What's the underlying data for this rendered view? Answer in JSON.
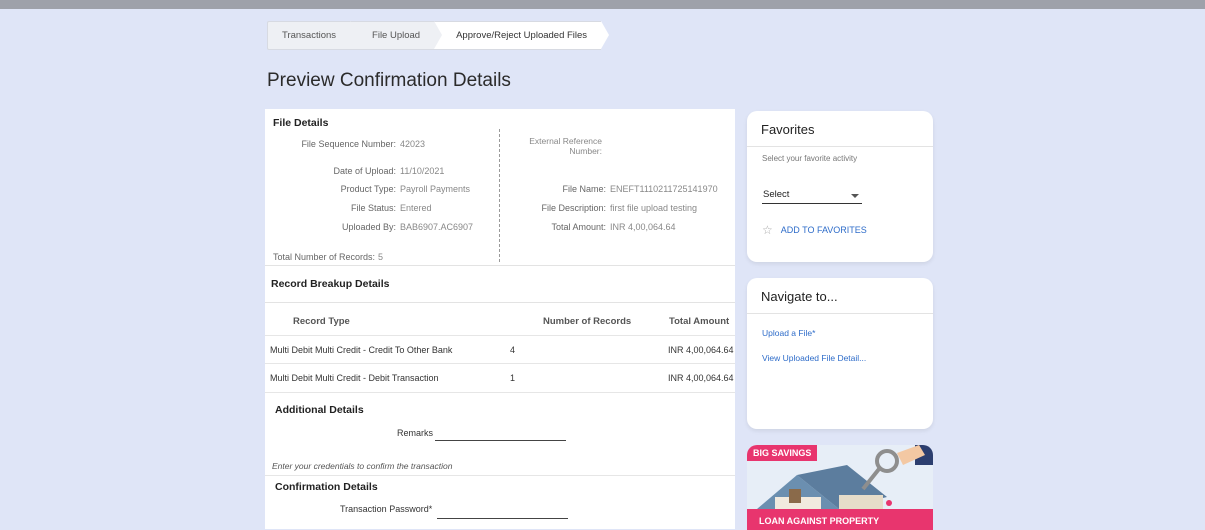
{
  "breadcrumb": [
    "Transactions",
    "File Upload",
    "Approve/Reject Uploaded Files"
  ],
  "page_title": "Preview Confirmation Details",
  "file_details": {
    "heading": "File Details",
    "left": [
      {
        "label": "File Sequence Number:",
        "value": "42023"
      },
      {
        "label": "Date of Upload:",
        "value": "11/10/2021"
      },
      {
        "label": "Product Type:",
        "value": "Payroll Payments"
      },
      {
        "label": "File Status:",
        "value": "Entered"
      },
      {
        "label": "Uploaded By:",
        "value": "BAB6907.AC6907"
      }
    ],
    "total_records_label": "Total Number of Records:",
    "total_records_value": "5",
    "external_ref_label": "External Reference Number:",
    "right": [
      {
        "label": "File Name:",
        "value": "ENEFT1110211725141970"
      },
      {
        "label": "File Description:",
        "value": "first file upload testing"
      },
      {
        "label": "Total Amount:",
        "value": "INR 4,00,064.64"
      }
    ]
  },
  "record_breakup": {
    "heading": "Record Breakup Details",
    "columns": [
      "Record Type",
      "Number of Records",
      "Total Amount"
    ],
    "rows": [
      {
        "type": "Multi Debit Multi Credit - Credit To Other Bank",
        "count": "4",
        "amount": "INR 4,00,064.64"
      },
      {
        "type": "Multi Debit Multi Credit - Debit Transaction",
        "count": "1",
        "amount": "INR 4,00,064.64"
      }
    ]
  },
  "additional": {
    "heading": "Additional Details",
    "remarks_label": "Remarks",
    "credentials_hint": "Enter your credentials to confirm the transaction"
  },
  "confirmation": {
    "heading": "Confirmation Details",
    "password_label": "Transaction Password*"
  },
  "favorites": {
    "title": "Favorites",
    "subtitle": "Select your favorite activity",
    "select_value": "Select",
    "add_label": "ADD TO FAVORITES"
  },
  "navigate": {
    "title": "Navigate to...",
    "links": [
      "Upload a File*",
      "View Uploaded File Detail..."
    ]
  },
  "ad": {
    "badge": "BIG SAVINGS",
    "strip": "LOAN AGAINST PROPERTY"
  }
}
